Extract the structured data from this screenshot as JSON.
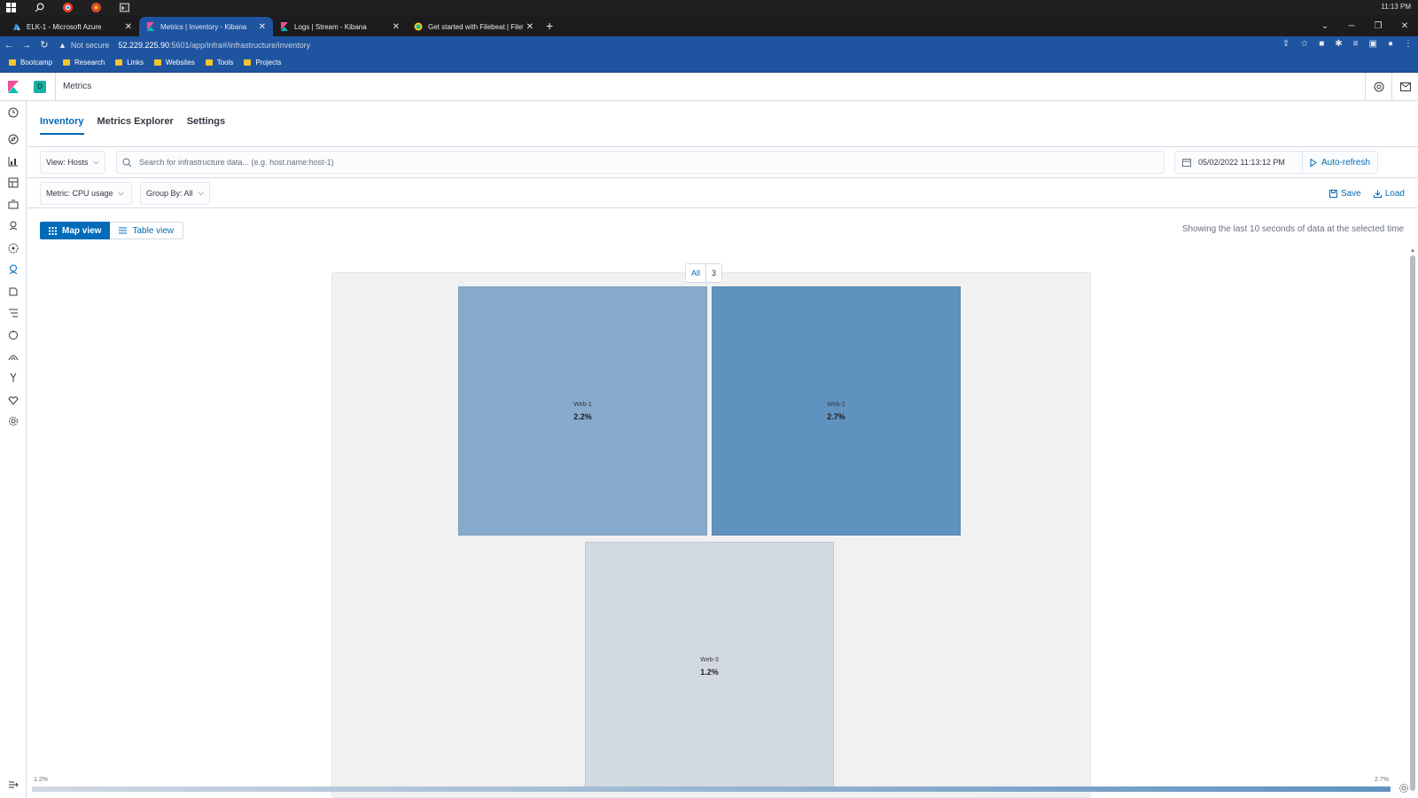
{
  "os": {
    "clock": "11:13 PM"
  },
  "browser": {
    "tabs": [
      {
        "title": "ELK-1 - Microsoft Azure",
        "icon": "azure-icon",
        "active": false
      },
      {
        "title": "Metrics | Inventory - Kibana",
        "icon": "kibana-icon",
        "active": true
      },
      {
        "title": "Logs | Stream - Kibana",
        "icon": "kibana-icon",
        "active": false
      },
      {
        "title": "Get started with Filebeat | Filebe...",
        "icon": "elastic-icon",
        "active": false
      }
    ],
    "address": {
      "security": "Not secure",
      "host": "52.229.225.90",
      "path": ":5601/app/infra#/infrastructure/inventory"
    },
    "bookmarks": [
      "Bootcamp",
      "Research",
      "Links",
      "Websites",
      "Tools",
      "Projects"
    ]
  },
  "kibana": {
    "space_initial": "D",
    "breadcrumb": "Metrics",
    "tabs": [
      "Inventory",
      "Metrics Explorer",
      "Settings"
    ],
    "view_select": "View: Hosts",
    "search_placeholder": "Search for infrastructure data... (e.g. host.name:host-1)",
    "date": "05/02/2022 11:13:12 PM",
    "auto_refresh": "Auto-refresh",
    "metric_select": "Metric: CPU usage",
    "group_by_select": "Group By: All",
    "save_label": "Save",
    "load_label": "Load",
    "map_view_label": "Map view",
    "table_view_label": "Table view",
    "showing_text": "Showing the last 10 seconds of data at the selected time"
  },
  "map": {
    "group_name": "All",
    "group_count": "3",
    "nodes": [
      {
        "name": "Web-1",
        "value": "2.2%",
        "color": "#88aacc"
      },
      {
        "name": "Web-2",
        "value": "2.7%",
        "color": "#6092c0"
      },
      {
        "name": "Web-3",
        "value": "1.2%",
        "color": "#d3d9e3"
      }
    ],
    "legend": {
      "min": "1.2%",
      "max": "2.7%",
      "min_color": "#d1d8e3",
      "max_color": "#6092c0"
    }
  },
  "colors": {
    "accent": "#006bb8",
    "chrome": "#1f55a0",
    "space": "#15b1a3"
  }
}
